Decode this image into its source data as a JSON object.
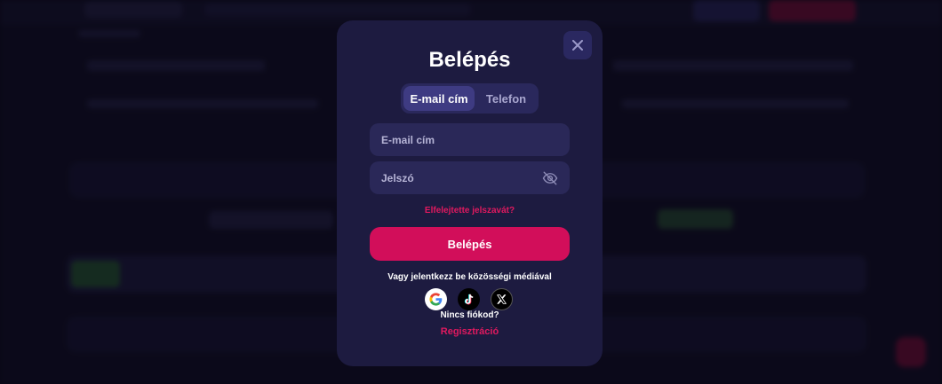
{
  "modal": {
    "title": "Belépés",
    "close_icon": "close-icon",
    "tabs": [
      {
        "label": "E-mail cím",
        "active": true
      },
      {
        "label": "Telefon",
        "active": false
      }
    ],
    "email_field": {
      "placeholder": "E-mail cím",
      "value": ""
    },
    "password_field": {
      "placeholder": "Jelszó",
      "value": "",
      "toggle_icon": "eye-off-icon"
    },
    "forgot_password": "Elfelejtette jelszavát?",
    "login_button": "Belépés",
    "social_text": "Vagy jelentkezz be közösségi médiával",
    "socials": [
      {
        "name": "google",
        "icon": "google-icon"
      },
      {
        "name": "tiktok",
        "icon": "tiktok-icon"
      },
      {
        "name": "x",
        "icon": "x-icon"
      }
    ],
    "no_account": "Nincs fiókod?",
    "register": "Regisztráció"
  },
  "colors": {
    "accent": "#d20e5a",
    "link": "#e0195f",
    "modal_bg": "#1d1b40",
    "field_bg": "#2a2858",
    "page_bg": "#0d0c1f"
  }
}
